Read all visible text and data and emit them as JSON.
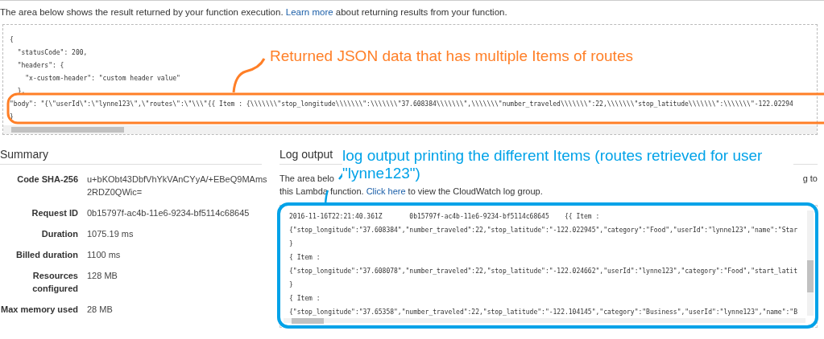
{
  "intro": {
    "before": "The area below shows the result returned by your function execution.",
    "link": "Learn more",
    "after": "about returning results from your function."
  },
  "result": {
    "lines": [
      "{",
      "  \"statusCode\": 200,",
      "  \"headers\": {",
      "    \"x-custom-header\": \"custom header value\"",
      "  },",
      "\"body\": \"{\\\"userId\\\":\\\"lynne123\\\",\\\"routes\\\":\\\"\\\\\\\"{{ Item : {\\\\\\\\\\\\\\\"stop_longitude\\\\\\\\\\\\\\\":\\\\\\\\\\\\\\\"37.608384\\\\\\\\\\\\\\\",\\\\\\\\\\\\\\\"number_traveled\\\\\\\\\\\\\\\":22,\\\\\\\\\\\\\\\"stop_latitude\\\\\\\\\\\\\\\":\\\\\\\\\\\\\\\"-122.02294",
      "}"
    ]
  },
  "summary": {
    "title": "Summary",
    "rows": [
      {
        "label": "Code SHA-256",
        "value": "u+bKObt43DbfVhYkVAnCYyA/+EBeQ9MAms 2RDZ0QWic="
      },
      {
        "label": "Request ID",
        "value": "0b15797f-ac4b-11e6-9234-bf5114c68645"
      },
      {
        "label": "Duration",
        "value": "1075.19 ms"
      },
      {
        "label": "Billed duration",
        "value": "1100 ms"
      },
      {
        "label": "Resources configured",
        "value": "128 MB"
      },
      {
        "label": "Max memory used",
        "value": "28 MB"
      }
    ]
  },
  "log": {
    "title": "Log output",
    "description_start": "The area belo",
    "description_end": "g to",
    "description_line2_before": "this Lambda function.",
    "description_link": "Click here",
    "description_line2_after": "to view the CloudWatch log group.",
    "lines": [
      "2016-11-16T22:21:40.361Z       0b15797f-ac4b-11e6-9234-bf5114c68645    {{ Item :",
      "{\"stop_longitude\":\"37.608384\",\"number_traveled\":22,\"stop_latitude\":\"-122.022945\",\"category\":\"Food\",\"userId\":\"lynne123\",\"name\":\"Star",
      "}",
      "{ Item :",
      "{\"stop_longitude\":\"37.608078\",\"number_traveled\":22,\"stop_latitude\":\"-122.024662\",\"userId\":\"lynne123\",\"category\":\"Food\",\"start_latit",
      "}",
      "{ Item :",
      "{\"stop_longitude\":\"37.65358\",\"number_traveled\":22,\"stop_latitude\":\"-122.104145\",\"category\":\"Business\",\"userId\":\"lynne123\",\"name\":\"B"
    ]
  },
  "annotations": [
    {
      "text": "Returned JSON data that has multiple Items of routes",
      "color": "#ff7f27"
    },
    {
      "text": "log output printing the different Items (routes retrieved for user \"lynne123\")",
      "color": "#00a2e8"
    }
  ]
}
